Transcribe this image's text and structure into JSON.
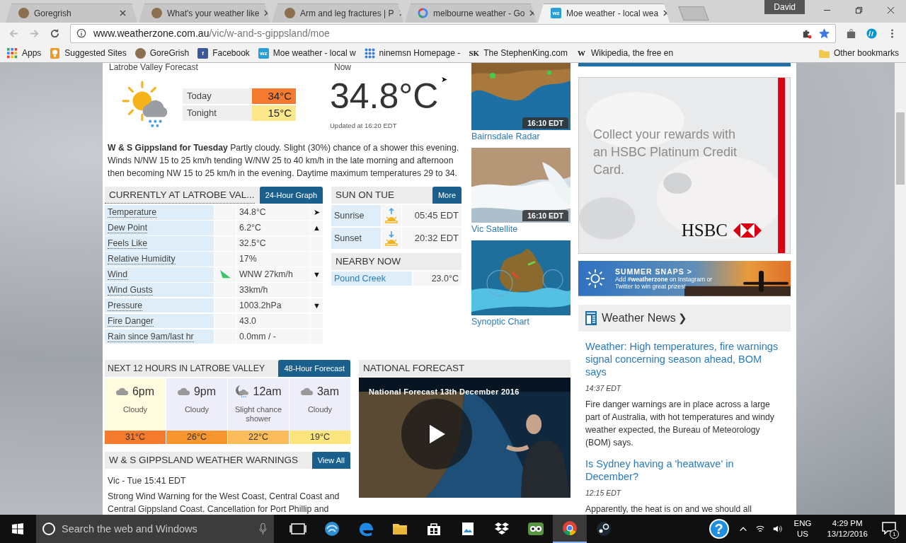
{
  "browser": {
    "tabs": [
      {
        "title": "Goregrish",
        "kind": "round",
        "selected": false
      },
      {
        "title": "What's your weather like",
        "kind": "round",
        "selected": false
      },
      {
        "title": "Arm and leg fractures | P",
        "kind": "round",
        "selected": false
      },
      {
        "title": "melbourne weather - Go",
        "kind": "ring",
        "selected": false
      },
      {
        "title": "Moe weather - local wea",
        "kind": "tile",
        "badge": "wz",
        "color": "#2a9fd6",
        "selected": true
      }
    ],
    "profile": "David",
    "address": {
      "domain": "www.weatherzone.com.au",
      "path": "/vic/w-and-s-gippsland/moe"
    },
    "bookmarked": true,
    "bookmarks": [
      {
        "label": "Apps",
        "kind": "grid"
      },
      {
        "label": "Suggested Sites",
        "kind": "bulb"
      },
      {
        "label": "GoreGrish",
        "kind": "round"
      },
      {
        "label": "Facebook",
        "kind": "tile",
        "badge": "f",
        "color": "#3b5998"
      },
      {
        "label": "Moe weather - local w",
        "kind": "tile",
        "badge": "wz",
        "color": "#2a9fd6"
      },
      {
        "label": "ninemsn Homepage -",
        "kind": "dots"
      },
      {
        "label": "The StephenKing.com",
        "kind": "mark",
        "badge": "SK"
      },
      {
        "label": "Wikipedia, the free en",
        "kind": "mark",
        "badge": "W"
      }
    ],
    "other_bookmarks": "Other bookmarks"
  },
  "page": {
    "forecast": {
      "heading": "Latrobe Valley Forecast",
      "periods": [
        {
          "label": "Today",
          "temp": "34°C",
          "color": "#f47a30"
        },
        {
          "label": "Tonight",
          "temp": "15°C",
          "color": "#fde98c"
        }
      ],
      "summary": "**W & S Gippsland for Tuesday** Partly cloudy. Slight (30%) chance of a shower this evening. Winds N/NW 15 to 25 km/h tending W/NW 25 to 40 km/h in the late morning and afternoon then becoming NW 15 to 25 km/h in the evening. Daytime maximum temperatures 29 to 34."
    },
    "now": {
      "heading": "Now",
      "temp": "34.8°C",
      "arrow": "➤",
      "updated": "Updated at 16:20 EDT"
    },
    "current": {
      "title": "CURRENTLY AT LATROBE VAL...",
      "button": "24-Hour Graph",
      "rows": [
        {
          "label": "Temperature",
          "value": "34.8°C",
          "trend": "➤",
          "kind": "plain"
        },
        {
          "label": "Dew Point",
          "value": "6.2°C",
          "trend": "▲",
          "kind": "plain"
        },
        {
          "label": "Feels Like",
          "value": "32.5°C",
          "kind": "plain"
        },
        {
          "label": "Relative Humidity",
          "value": "17%",
          "kind": "plain"
        },
        {
          "label": "Wind",
          "value": "WNW 27km/h",
          "trend": "▼",
          "kind": "wind"
        },
        {
          "label": "Wind Gusts",
          "value": "33km/h",
          "kind": "plain"
        },
        {
          "label": "Pressure",
          "value": "1003.2hPa",
          "trend": "▼",
          "kind": "plain"
        },
        {
          "label": "Fire Danger",
          "value": "43.0",
          "kind": "plain"
        },
        {
          "label": "Rain since 9am/last hr",
          "value": "0.0mm / -",
          "kind": "plain"
        }
      ]
    },
    "sun": {
      "title": "SUN ON TUE",
      "button": "More",
      "rows": [
        {
          "label": "Sunrise",
          "time": "05:45 EDT",
          "kind": "sunrise"
        },
        {
          "label": "Sunset",
          "time": "20:32 EDT",
          "kind": "sunset"
        }
      ]
    },
    "nearby": {
      "title": "NEARBY NOW",
      "rows": [
        {
          "place": "Pound Creek",
          "temp": "23.0°C"
        }
      ]
    },
    "maps": [
      {
        "caption": "Bairnsdale Radar",
        "kind": "radar",
        "stamp": "16:10 EDT"
      },
      {
        "caption": "Vic Satellite",
        "kind": "satellite",
        "stamp": "16:10 EDT"
      },
      {
        "caption": "Synoptic Chart",
        "kind": "synoptic"
      }
    ],
    "hours": {
      "title": "NEXT 12 HOURS IN LATROBE VALLEY",
      "button": "48-Hour Forecast",
      "periods": [
        {
          "time": "6pm",
          "kind": "cloud",
          "condition": "Cloudy",
          "temp": "31°C",
          "color": "#f47a2e",
          "current": true
        },
        {
          "time": "9pm",
          "kind": "cloud",
          "condition": "Cloudy",
          "temp": "26°C",
          "color": "#f7952e",
          "current": false
        },
        {
          "time": "12am",
          "kind": "moon-shower",
          "condition": "Slight chance shower",
          "temp": "22°C",
          "color": "#fbbd5c",
          "current": false
        },
        {
          "time": "3am",
          "kind": "cloud",
          "condition": "Cloudy",
          "temp": "19°C",
          "color": "#fde57e",
          "current": false
        }
      ]
    },
    "warnings": {
      "title": "W & S GIPPSLAND WEATHER WARNINGS",
      "button": "View All",
      "items": [
        {
          "issued": "Vic - Tue 15:41 EDT",
          "text": "Strong Wind Warning for the West Coast, Central Coast and Central Gippsland Coast. Cancellation for Port Phillip and"
        }
      ]
    },
    "video": {
      "title": "NATIONAL FORECAST",
      "caption": "National Forecast 13th December 2016"
    },
    "ad": {
      "text": "Collect your rewards with an HSBC Platinum Credit Card.",
      "brand": "HSBC"
    },
    "promo": {
      "title": "SUMMER SNAPS >",
      "text": "Add **#weatherzone** on Instagram or Twitter to win great prizes!"
    },
    "news": {
      "title": "Weather News",
      "arrow": "❯",
      "items": [
        {
          "title": "Weather: High temperatures, fire warnings signal concerning season ahead, BOM says",
          "time": "14:37 EDT",
          "summary": "Fire danger warnings are in place across a large part of Australia, with hot temperatures and windy weather expected, the Bureau of Meteorology (BOM) says."
        },
        {
          "title": "Is Sydney having a 'heatwave' in December?",
          "time": "12:15 EDT",
          "summary": "Apparently, the heat is on and we should all"
        }
      ]
    }
  },
  "taskbar": {
    "search": "Search the web and Windows",
    "apps": [
      {
        "kind": "taskview",
        "selected": false
      },
      {
        "kind": "globe",
        "selected": false
      },
      {
        "kind": "edge",
        "selected": false
      },
      {
        "kind": "folder",
        "selected": false
      },
      {
        "kind": "store",
        "selected": false
      },
      {
        "kind": "photos",
        "selected": false
      },
      {
        "kind": "dropbox",
        "selected": false
      },
      {
        "kind": "owl",
        "selected": false
      },
      {
        "kind": "chrome",
        "selected": true
      },
      {
        "kind": "steam",
        "selected": false
      }
    ],
    "help": "?",
    "lang": "ENG",
    "region": "US",
    "time": "4:29 PM",
    "date": "13/12/2016",
    "notifications": "1"
  }
}
